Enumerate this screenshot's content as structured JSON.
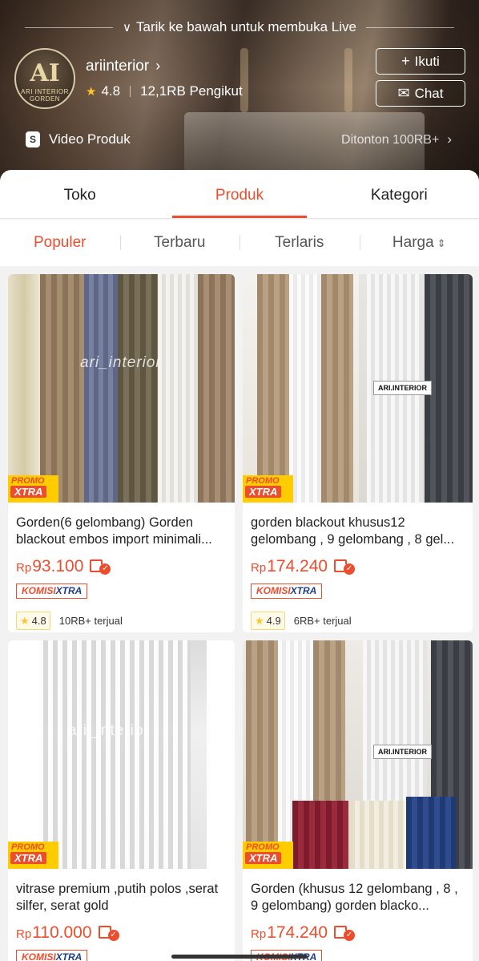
{
  "header": {
    "pull_hint": "Tarik ke bawah untuk membuka Live",
    "shop_name": "ariinterior",
    "logo_text_line1": "ARI INTERIOR",
    "logo_text_line2": "GORDEN",
    "rating": "4.8",
    "followers": "12,1RB Pengikut",
    "follow_label": "Ikuti",
    "chat_label": "Chat",
    "video_label": "Video Produk",
    "views_label": "Ditonton 100RB+"
  },
  "tabs": [
    "Toko",
    "Produk",
    "Kategori"
  ],
  "active_tab": "Produk",
  "sorts": [
    "Populer",
    "Terbaru",
    "Terlaris",
    "Harga"
  ],
  "active_sort": "Populer",
  "promo": {
    "line1": "PROMO",
    "line2": "XTRA"
  },
  "komisi": {
    "part1": "KOMISI",
    "part2": "XTRA"
  },
  "products": [
    {
      "title": "Gorden(6 gelombang) Gorden blackout embos import minimali...",
      "currency": "Rp",
      "price": "93.100",
      "rating": "4.8",
      "sold": "10RB+ terjual",
      "watermark": "ari_interior"
    },
    {
      "title": "gorden blackout khusus12 gelombang , 9 gelombang , 8 gel...",
      "currency": "Rp",
      "price": "174.240",
      "rating": "4.9",
      "sold": "6RB+ terjual",
      "watermark": "ARI.INTERIOR"
    },
    {
      "title": "vitrase premium ,putih polos ,serat silfer, serat gold",
      "currency": "Rp",
      "price": "110.000",
      "watermark": "ari_interior"
    },
    {
      "title": "Gorden (khusus 12 gelombang , 8 , 9 gelombang) gorden blacko...",
      "currency": "Rp",
      "price": "174.240",
      "watermark": "ARI.INTERIOR"
    }
  ]
}
